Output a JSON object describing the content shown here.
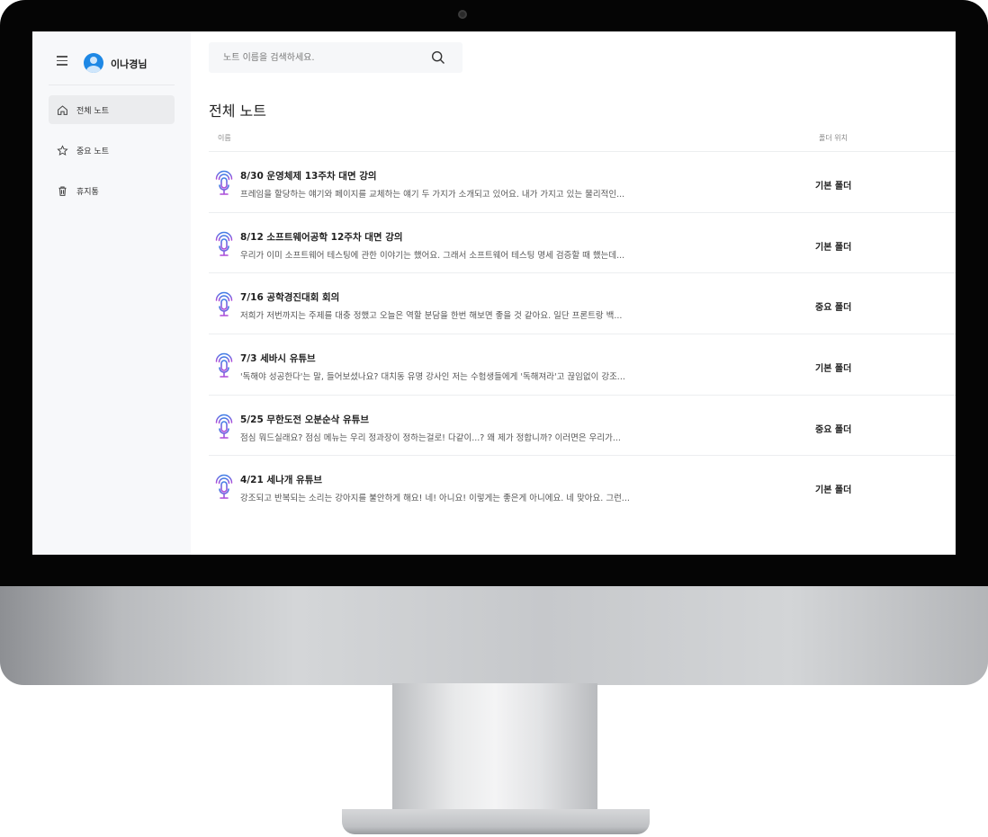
{
  "user": {
    "name": "이나경님"
  },
  "search": {
    "placeholder": "노트 이름을 검색하세요."
  },
  "sidebar": {
    "items": [
      {
        "label": "전체 노트",
        "icon": "home-icon",
        "active": true
      },
      {
        "label": "중요 노트",
        "icon": "star-icon",
        "active": false
      },
      {
        "label": "휴지통",
        "icon": "trash-icon",
        "active": false
      }
    ]
  },
  "main": {
    "title": "전체 노트",
    "columns": {
      "name": "이름",
      "folder": "폴더 위치"
    },
    "notes": [
      {
        "title": "8/30 운영체제 13주차 대면 강의",
        "preview": "프레임을 할당하는 얘기와 페이지를 교체하는 얘기 두 가지가 소개되고 있어요. 내가 가지고 있는 물리적인...",
        "folder": "기본 폴더",
        "icon": "microphone-icon"
      },
      {
        "title": "8/12 소프트웨어공학 12주차 대면 강의",
        "preview": "우리가 이미 소프트웨어 테스팅에 관한 이야기는 했어요. 그래서 소프트웨어 테스팅 명세 검증할 때 했는데...",
        "folder": "기본 폴더",
        "icon": "microphone-icon"
      },
      {
        "title": "7/16 공학경진대회 회의",
        "preview": "저희가 저번까지는 주제를 대충 정했고 오늘은 역할 분담을 한번 해보면 좋을 것 같아요. 일단 프론트랑 백...",
        "folder": "중요 폴더",
        "icon": "microphone-icon"
      },
      {
        "title": "7/3 세바시 유튜브",
        "preview": "'독해야 성공한다'는 말, 들어보셨나요? 대치동 유명 강사인 저는 수험생들에게 '독해져라'고 끊임없이 강조...",
        "folder": "기본 폴더",
        "icon": "microphone-icon"
      },
      {
        "title": "5/25 무한도전 오분순삭 유튜브",
        "preview": "점심 뭐드실래요? 점심 메뉴는 우리 정과장이 정하는걸로! 다같이...? 왜 제가 정합니까? 이러면은 우리가...",
        "folder": "중요 폴더",
        "icon": "microphone-icon"
      },
      {
        "title": "4/21 세나개 유튜브",
        "preview": "강조되고 반복되는 소리는 강아지를 불안하게 해요! 네! 아니요! 이렇게는 좋은게 아니에요. 네 맞아요. 그런...",
        "folder": "기본 폴더",
        "icon": "microphone-icon"
      }
    ]
  },
  "colors": {
    "accent_purple": "#9b4de0",
    "accent_blue": "#3f7fe6",
    "sidebar_bg": "#f7f8fa",
    "avatar_blue": "#1e88e5"
  }
}
